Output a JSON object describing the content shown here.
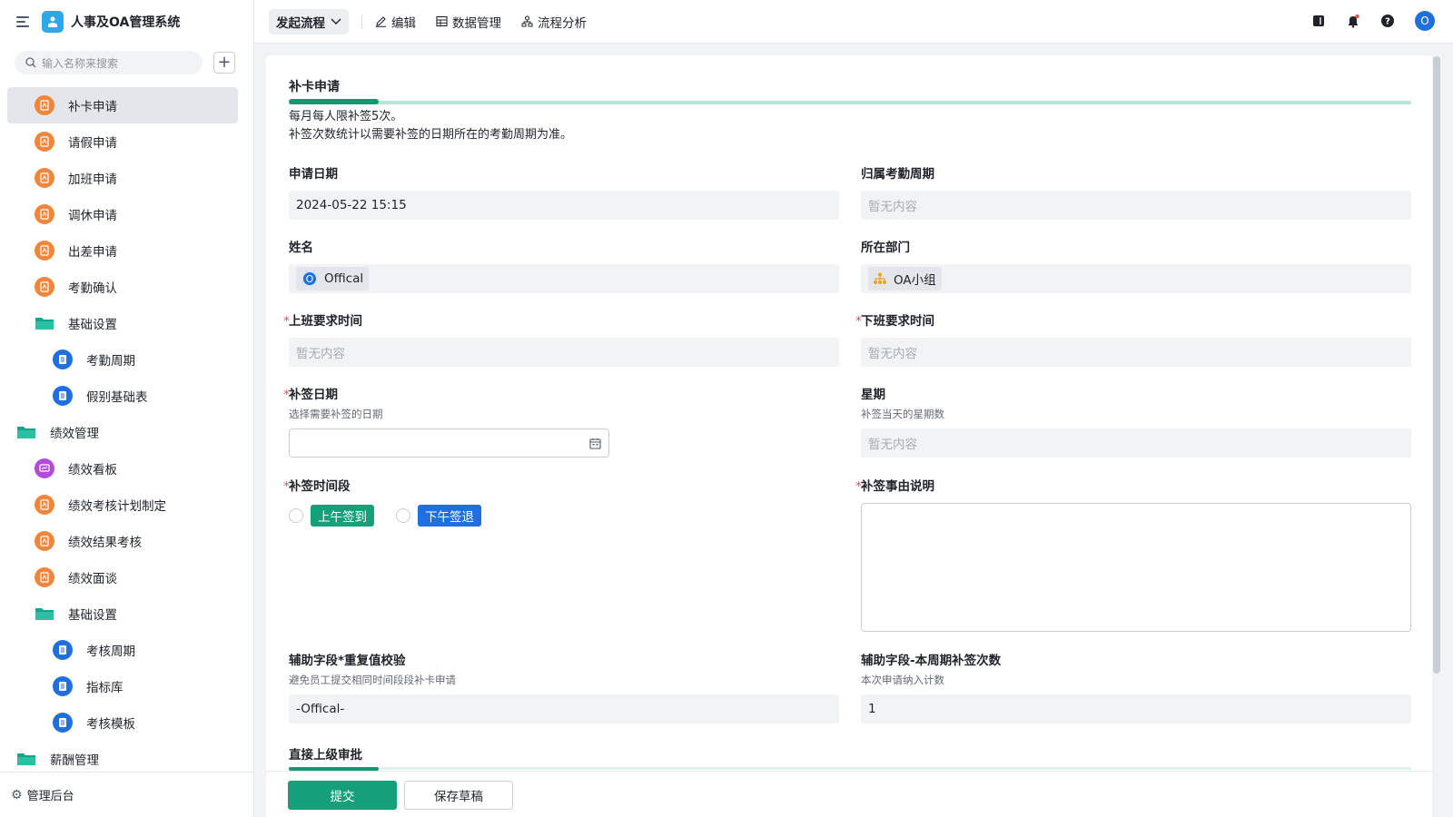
{
  "app": {
    "title": "人事及OA管理系统"
  },
  "search": {
    "placeholder": "输入名称来搜索"
  },
  "sidebar": {
    "items": [
      {
        "label": "补卡申请",
        "icon": "form-icon",
        "color": "orange"
      },
      {
        "label": "请假申请",
        "icon": "form-icon",
        "color": "orange"
      },
      {
        "label": "加班申请",
        "icon": "form-icon",
        "color": "orange"
      },
      {
        "label": "调休申请",
        "icon": "form-icon",
        "color": "orange"
      },
      {
        "label": "出差申请",
        "icon": "form-icon",
        "color": "orange"
      },
      {
        "label": "考勤确认",
        "icon": "form-icon",
        "color": "orange"
      },
      {
        "label": "基础设置",
        "icon": "folder-icon",
        "color": "teal"
      },
      {
        "label": "考勤周期",
        "icon": "doc-icon",
        "color": "blue"
      },
      {
        "label": "假别基础表",
        "icon": "doc-icon",
        "color": "blue"
      },
      {
        "label": "绩效管理",
        "icon": "folder-icon",
        "color": "teal"
      },
      {
        "label": "绩效看板",
        "icon": "dashboard-icon",
        "color": "purple"
      },
      {
        "label": "绩效考核计划制定",
        "icon": "form-icon",
        "color": "orange"
      },
      {
        "label": "绩效结果考核",
        "icon": "form-icon",
        "color": "orange"
      },
      {
        "label": "绩效面谈",
        "icon": "form-icon",
        "color": "orange"
      },
      {
        "label": "基础设置",
        "icon": "folder-icon",
        "color": "teal"
      },
      {
        "label": "考核周期",
        "icon": "doc-icon",
        "color": "blue"
      },
      {
        "label": "指标库",
        "icon": "doc-icon",
        "color": "blue"
      },
      {
        "label": "考核模板",
        "icon": "doc-icon",
        "color": "blue"
      },
      {
        "label": "薪酬管理",
        "icon": "folder-icon",
        "color": "teal"
      }
    ],
    "footer_label": "管理后台"
  },
  "toolbar": {
    "start_flow": "发起流程",
    "edit": "编辑",
    "data_manage": "数据管理",
    "flow_analysis": "流程分析",
    "avatar_letter": "O"
  },
  "form": {
    "section_title": "补卡申请",
    "progress": 0.08,
    "desc_line1": "每月每人限补签5次。",
    "desc_line2": "补签次数统计以需要补签的日期所在的考勤周期为准。",
    "apply_date": {
      "label": "申请日期",
      "value": "2024-05-22 15:15"
    },
    "attendance_cycle": {
      "label": "归属考勤周期",
      "value": "暂无内容"
    },
    "name": {
      "label": "姓名",
      "value": "Offical",
      "avatar": "O"
    },
    "department": {
      "label": "所在部门",
      "value": "OA小组"
    },
    "work_start": {
      "label": "上班要求时间",
      "value": "暂无内容"
    },
    "work_end": {
      "label": "下班要求时间",
      "value": "暂无内容"
    },
    "sign_date": {
      "label": "补签日期",
      "hint": "选择需要补签的日期"
    },
    "weekday": {
      "label": "星期",
      "hint": "补签当天的星期数",
      "value": "暂无内容"
    },
    "time_slot": {
      "label": "补签时间段",
      "options": [
        "上午签到",
        "下午签退"
      ]
    },
    "reason": {
      "label": "补签事由说明"
    },
    "dup_check": {
      "label": "辅助字段*重复值校验",
      "hint": "避免员工提交相同时间段段补卡申请",
      "value": "-Offical-"
    },
    "count": {
      "label": "辅助字段-本周期补签次数",
      "hint": "本次申请纳入计数",
      "value": "1"
    },
    "approval_title": "直接上级审批",
    "submit": "提交",
    "save_draft": "保存草稿"
  },
  "colors": {
    "primary": "#16a07a",
    "blue": "#1f6fe0",
    "orange": "#f0863a"
  }
}
